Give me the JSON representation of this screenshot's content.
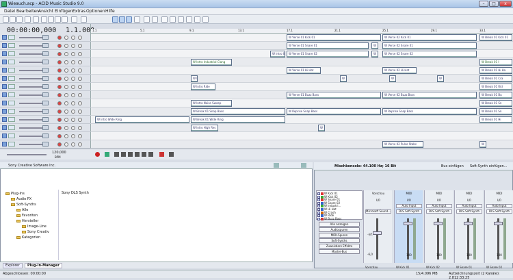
{
  "window": {
    "title": "Wieauch.acp - ACID Music Studio 9.0",
    "min": "–",
    "max": "□",
    "close": "x"
  },
  "menu": [
    "Datei",
    "Bearbeiten",
    "Ansicht",
    "Einfügen",
    "Extras",
    "Optionen",
    "Hilfe"
  ],
  "time_display": "00:00:00,000",
  "measure_display": "1.1.000",
  "ruler": [
    {
      "label": "1.1"
    },
    {
      "label": "5.1"
    },
    {
      "label": "9.1"
    },
    {
      "label": "13.1"
    },
    {
      "label": "17.1"
    },
    {
      "label": "21.1"
    },
    {
      "label": "25.1"
    },
    {
      "label": "29.1"
    },
    {
      "label": "33.1"
    }
  ],
  "tempo": {
    "bpm": "120,000",
    "unit": "BPM"
  },
  "lanes": [
    [
      {
        "name": "W Verse 01 Kick 01"
      },
      {
        "name": "W Verse 02 Kick 01"
      },
      {
        "name": "W Break 01 Kick 01"
      }
    ],
    [
      {
        "name": "W Verse 01 Snare 01"
      },
      {
        "name": "W"
      },
      {
        "name": "W Verse 02 Snare 01"
      }
    ],
    [
      {
        "name": "W Intro 01"
      },
      {
        "name": "W Verse 01 Snare 02"
      },
      {
        "name": "W"
      },
      {
        "name": "W Verse 02 Snare 02"
      }
    ],
    [
      {
        "name": "W Intro Industrial Clang",
        "green": true
      },
      {
        "name": "W Break 01 I",
        "green": true
      }
    ],
    [
      {
        "name": "W Verse 01 Hi Hat"
      },
      {
        "name": "W Verse 02 Hi Hat"
      },
      {
        "name": "W Break 01 Hi Ha"
      }
    ],
    [
      {
        "name": "W Intro 1"
      },
      {
        "name": "W"
      },
      {
        "name": "W"
      },
      {
        "name": "W"
      },
      {
        "name": "W Break 01 Cra"
      }
    ],
    [
      {
        "name": "W Intro Ride"
      },
      {
        "name": "W Break 01 Rid"
      }
    ],
    [
      {
        "name": "W Verse 01 Buzz Bass"
      },
      {
        "name": "W Verse 02 Buzz Bass"
      },
      {
        "name": "W Break 01 Bu"
      }
    ],
    [
      {
        "name": "W Intro Noise Sweep"
      },
      {
        "name": "W Break 01 Sn"
      }
    ],
    [
      {
        "name": "W Break 01 Snap Bass"
      },
      {
        "name": "W Reprise Snap Bass"
      },
      {
        "name": "W Reprise Snap Bass"
      },
      {
        "name": "W Break 01 Sn"
      }
    ],
    [
      {
        "name": "W Intro Wide Ring"
      },
      {
        "name": "W Break 01 Wide Ring"
      },
      {
        "name": "W Break 01 Hi"
      }
    ],
    [
      {
        "name": "W Intro High Res"
      },
      {
        "name": "W"
      }
    ],
    [],
    [
      {
        "name": "W Verse 02 Pulse Stabs"
      },
      {
        "name": "W"
      }
    ]
  ],
  "explorer": {
    "path": "Sony Creative Software Inc.",
    "detail": "Sony DLS Synth",
    "tree": [
      "Plug-Ins",
      "Audio FX",
      "Soft-Synths",
      "Alle",
      "Favoriten",
      "Hersteller",
      "Image-Line",
      "Sony Creativ",
      "Kategorien"
    ],
    "tabs": [
      "Explorer",
      "Plug-In-Manager"
    ]
  },
  "mixer": {
    "title": "Mischkonsole: 44.100 Hz; 16 Bit",
    "bus_label": "Bus einfügen",
    "synth_label": "Soft-Synth einfügen...",
    "buses": [
      "W Kick 01",
      "W Kick 02",
      "W Snare 01",
      "W Snare 02",
      "W Industri...",
      "W Hi Hat",
      "W Crash",
      "W Ride",
      "W Buzz Bass"
    ],
    "bus_colors": [
      "#d33",
      "#3a3",
      "#d33",
      "#36c",
      "#3a3",
      "#36c",
      "#c60",
      "#36c",
      "#c33"
    ],
    "buttons": [
      "Alle anzeigen",
      "Audiospuren",
      "MIDI-Spuren",
      "Soft-Synths",
      "Zuweisbare Effekte",
      "Master-Bus"
    ],
    "preview": {
      "label": "Vorschau",
      "io": "I/O",
      "device": "Microsoft Sound...",
      "db_top": "-Inf.",
      "db_bottom": "-6,0",
      "name": "Vorschau"
    },
    "strips": [
      {
        "type": "MIDI",
        "io": "I/O",
        "input": "Auto Input",
        "device": "DLS Soft-Synth",
        "pan": "Mitte",
        "vol": "100",
        "name": "W Kick 01",
        "sel": true
      },
      {
        "type": "MIDI",
        "io": "I/O",
        "input": "Auto Input",
        "device": "DLS Soft-Synth",
        "pan": "Mitte",
        "vol": "100",
        "name": "W Kick 02",
        "sel": false
      },
      {
        "type": "MIDI",
        "io": "I/O",
        "input": "Auto Input",
        "device": "DLS Soft-Synth",
        "pan": "Mitte",
        "vol": "100",
        "name": "W Snare 01",
        "sel": false
      },
      {
        "type": "MIDI",
        "io": "I/O",
        "input": "Auto Input",
        "device": "DLS Soft-Synth",
        "pan": "Mitte",
        "vol": "100",
        "name": "W Snare 02",
        "sel": false
      }
    ]
  },
  "status": {
    "left": "Abgeschlossen: 00:00:00",
    "mem": "15/4.096 MB",
    "rec": "Aufzeichnungszeit (2 Kanäle): 2.812:33:25"
  }
}
